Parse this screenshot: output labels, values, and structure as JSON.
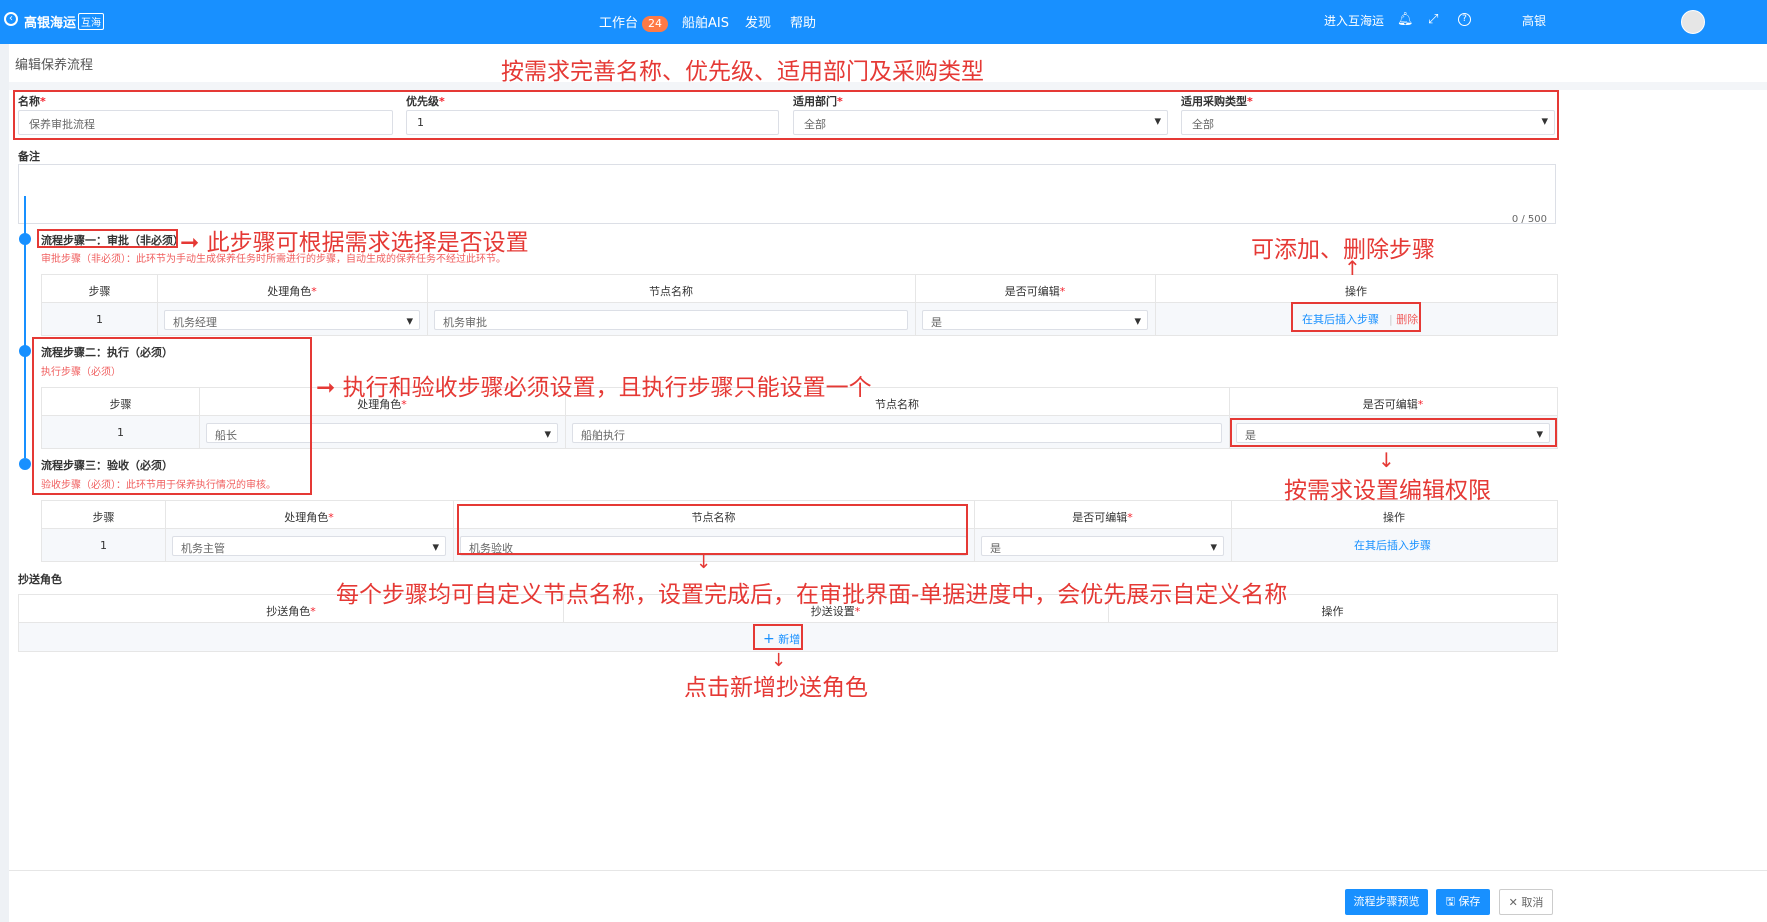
{
  "topbar": {
    "brand": "高银海运",
    "brand_badge": "互海",
    "nav": [
      {
        "label": "工作台",
        "badge": "24"
      },
      {
        "label": "船舶AIS"
      },
      {
        "label": "发现"
      },
      {
        "label": "帮助"
      }
    ],
    "enter_label": "进入互海运",
    "user_name": "高银",
    "icons": [
      "back-icon",
      "bell-icon",
      "fullscreen-icon",
      "help-icon"
    ]
  },
  "page": {
    "title": "编辑保养流程"
  },
  "form": {
    "name_label": "名称",
    "name_value": "保养审批流程",
    "priority_label": "优先级",
    "priority_value": "1",
    "dept_label": "适用部门",
    "dept_value": "全部",
    "purchase_label": "适用采购类型",
    "purchase_value": "全部",
    "remark_label": "备注",
    "remark_counter": "0 / 500"
  },
  "steps": [
    {
      "title": "流程步骤一：审批（非必须）",
      "desc": "审批步骤（非必须）：此环节为手动生成保养任务时所需进行的步骤，自动生成的保养任务不经过此环节。",
      "headers": [
        "步骤",
        "处理角色",
        "节点名称",
        "是否可编辑",
        "操作"
      ],
      "row": {
        "step": "1",
        "role": "机务经理",
        "node": "机务审批",
        "editable": "是"
      },
      "actions": {
        "insert": "在其后插入步骤",
        "delete": "删除"
      }
    },
    {
      "title": "流程步骤二：执行（必须）",
      "desc": "执行步骤（必须）",
      "headers": [
        "步骤",
        "处理角色",
        "节点名称",
        "是否可编辑"
      ],
      "row": {
        "step": "1",
        "role": "船长",
        "node": "船舶执行",
        "editable": "是"
      }
    },
    {
      "title": "流程步骤三：验收（必须）",
      "desc": "验收步骤（必须）：此环节用于保养执行情况的审核。",
      "headers": [
        "步骤",
        "处理角色",
        "节点名称",
        "是否可编辑",
        "操作"
      ],
      "row": {
        "step": "1",
        "role": "机务主管",
        "node": "机务验收",
        "editable": "是"
      },
      "actions": {
        "insert": "在其后插入步骤"
      }
    }
  ],
  "cc": {
    "label": "抄送角色",
    "headers": [
      "抄送角色",
      "抄送设置",
      "操作"
    ],
    "add_label": "新增"
  },
  "annotations": {
    "a1": "按需求完善名称、优先级、适用部门及采购类型",
    "a2": "此步骤可根据需求选择是否设置",
    "a3": "可添加、删除步骤",
    "a4": "执行和验收步骤必须设置，且执行步骤只能设置一个",
    "a5": "按需求设置编辑权限",
    "a6": "每个步骤均可自定义节点名称，设置完成后，在审批界面-单据进度中，会优先展示自定义名称",
    "a7": "点击新增抄送角色"
  },
  "footer": {
    "preview_label": "流程步骤预览",
    "save_label": "保存",
    "cancel_label": "取消"
  },
  "colors": {
    "primary": "#1890ff",
    "annotation": "#e53935",
    "required": "#f5222d"
  }
}
